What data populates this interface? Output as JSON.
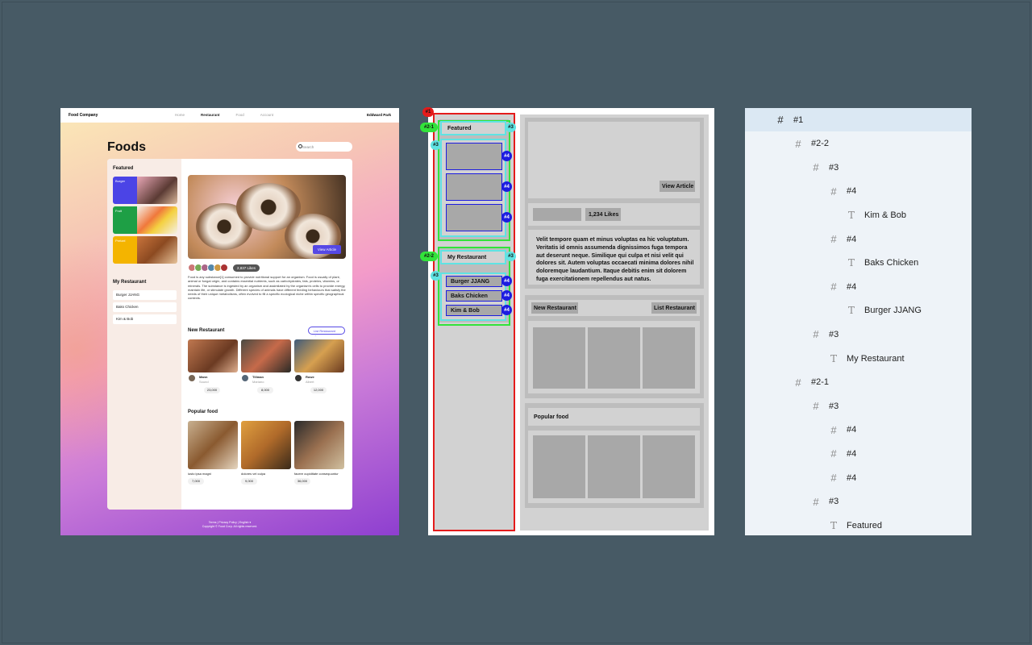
{
  "mockup": {
    "brand": "Food Company",
    "nav": [
      "Home",
      "Restaurant",
      "Food",
      "Account"
    ],
    "user": "Eddward Park",
    "title": "Foods",
    "search_placeholder": "Search",
    "featured_title": "Featured",
    "featured": [
      {
        "label": "Burger",
        "color": "#4b44e6"
      },
      {
        "label": "Fruit",
        "color": "#1e9f45"
      },
      {
        "label": "Pretzel",
        "color": "#f4b400"
      }
    ],
    "my_restaurant_title": "My Restaurant",
    "my_restaurants": [
      "Burger JJANG",
      "Baks Chicken",
      "Kim & Bob"
    ],
    "view_article": "View Article",
    "likes": "2,837 Likes",
    "description": "Food is any substance[1] consumed to provide nutritional support for an organism. Food is usually of plant, animal or fungal origin, and contains essential nutrients, such as carbohydrates, fats, proteins, vitamins, or minerals. The substance is ingested by an organism and assimilated by the organism's cells to provide energy, maintain life, or stimulate growth. Different species of animals have different feeding behaviours that satisfy the needs of their unique metabolisms, often evolved to fill a specific ecological niche within specific geographical contexts.",
    "new_restaurant_title": "New Restaurant",
    "list_restaurant": "List Restaurant",
    "new_restaurants": [
      {
        "name": "Mann",
        "sub": "Sound",
        "price": "23,000",
        "stats": "1,040 · 8k"
      },
      {
        "name": "Tillman",
        "sub": "Mariano",
        "price": "8,000",
        "stats": "1,041 · 8k"
      },
      {
        "name": "Rowe",
        "sub": "Albert",
        "price": "12,000",
        "stats": "1,043 · 8k"
      }
    ],
    "popular_title": "Popular food",
    "popular": [
      {
        "name": "iusto ipsa magni",
        "price": "7,000"
      },
      {
        "name": "dolores vel culpa",
        "price": "9,000"
      },
      {
        "name": "facere cupiditate consequuntur",
        "price": "36,000"
      }
    ],
    "footer_line1": "Terms | Privacy Policy | English ▾",
    "footer_line2": "Copyright © Food Corp. All rights reserved."
  },
  "wireframe": {
    "featured": "Featured",
    "my_restaurant": "My Restaurant",
    "restaurants": [
      "Burger JJANG",
      "Baks Chicken",
      "Kim & Bob"
    ],
    "view_article": "View Article",
    "likes": "1,234 Likes",
    "body": "Velit tempore quam et minus voluptas ea hic voluptatum. Veritatis id omnis assumenda dignissimos fuga tempora aut deserunt neque. Similique qui culpa et nisi velit qui dolores sit. Autem voluptas occaecati minima dolores nihil doloremque laudantium. Itaque debitis enim sit dolorem fuga exercitationem repellendus aut natus.",
    "new_restaurant": "New Restaurant",
    "list_restaurant": "List Restaurant",
    "popular_food": "Popular food",
    "badges": {
      "b1": "#1",
      "b21": "#2-1",
      "b22": "#2-2",
      "b3": "#3",
      "b4": "#4"
    }
  },
  "layers": [
    {
      "kind": "frame",
      "label": "#1",
      "depth": 0,
      "selected": true
    },
    {
      "kind": "frame",
      "label": "#2-2",
      "depth": 1
    },
    {
      "kind": "frame",
      "label": "#3",
      "depth": 2
    },
    {
      "kind": "frame",
      "label": "#4",
      "depth": 3
    },
    {
      "kind": "text",
      "label": "Kim & Bob",
      "depth": 4
    },
    {
      "kind": "frame",
      "label": "#4",
      "depth": 3
    },
    {
      "kind": "text",
      "label": "Baks Chicken",
      "depth": 4
    },
    {
      "kind": "frame",
      "label": "#4",
      "depth": 3
    },
    {
      "kind": "text",
      "label": "Burger JJANG",
      "depth": 4
    },
    {
      "kind": "frame",
      "label": "#3",
      "depth": 2
    },
    {
      "kind": "text",
      "label": "My Restaurant",
      "depth": 3
    },
    {
      "kind": "frame",
      "label": "#2-1",
      "depth": 1
    },
    {
      "kind": "frame",
      "label": "#3",
      "depth": 2
    },
    {
      "kind": "frame",
      "label": "#4",
      "depth": 3
    },
    {
      "kind": "frame",
      "label": "#4",
      "depth": 3
    },
    {
      "kind": "frame",
      "label": "#4",
      "depth": 3
    },
    {
      "kind": "frame",
      "label": "#3",
      "depth": 2
    },
    {
      "kind": "text",
      "label": "Featured",
      "depth": 3
    }
  ],
  "icons": {
    "frame": "frame-hash-icon",
    "text": "text-T-icon"
  }
}
